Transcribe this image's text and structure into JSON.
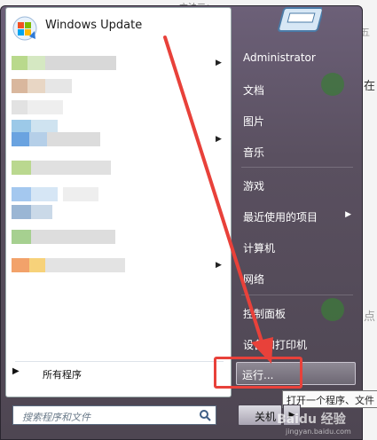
{
  "background": {
    "top_text": "方法三：",
    "side_char_1": "五",
    "side_char_2": "在",
    "side_char_3": "点"
  },
  "left_pane": {
    "pinned_app": "Windows Update",
    "all_programs": "所有程序",
    "search_placeholder": "搜索程序和文件"
  },
  "right_pane": {
    "items": [
      {
        "label": "Administrator",
        "has_submenu": false
      },
      {
        "label": "文档",
        "has_submenu": false
      },
      {
        "label": "图片",
        "has_submenu": false
      },
      {
        "label": "音乐",
        "has_submenu": false
      },
      {
        "label": "游戏",
        "has_submenu": false
      },
      {
        "label": "最近使用的项目",
        "has_submenu": true
      },
      {
        "label": "计算机",
        "has_submenu": false
      },
      {
        "label": "网络",
        "has_submenu": false
      },
      {
        "label": "控制面板",
        "has_submenu": false
      },
      {
        "label": "设备和打印机",
        "has_submenu": false
      }
    ],
    "run_label": "运行...",
    "shutdown_label": "关机"
  },
  "tooltip": "打开一个程序、文件",
  "watermark": {
    "main": "Baidu 经验",
    "sub": "jingyan.baidu.com"
  },
  "colors": {
    "annotation": "#e8413a",
    "menu_bg": "#5a5060"
  }
}
